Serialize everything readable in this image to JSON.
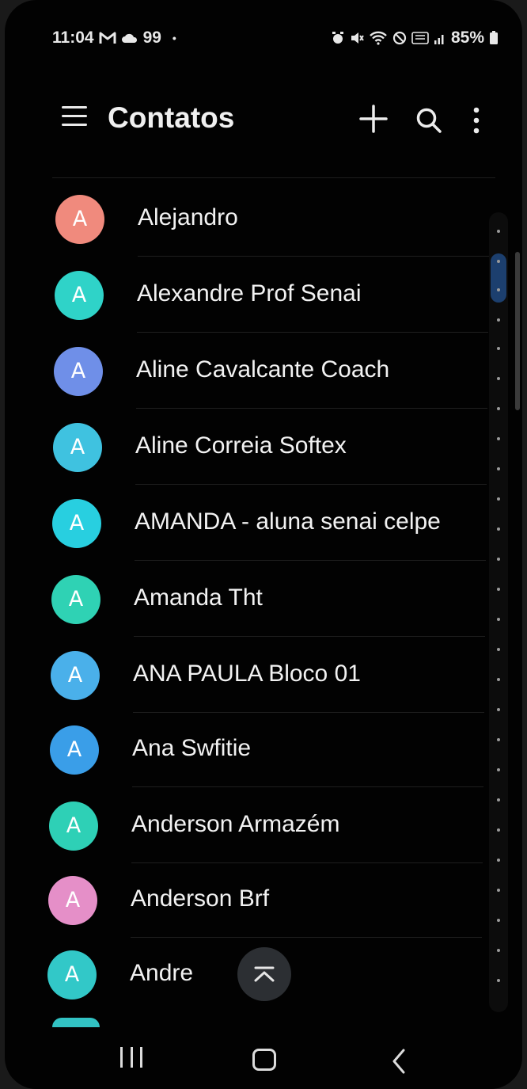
{
  "status": {
    "time": "11:04",
    "notification_icons": [
      "gmail-icon",
      "cloud-icon"
    ],
    "notification_text": "99",
    "dot": "•",
    "battery": "85%"
  },
  "appbar": {
    "title": "Contatos"
  },
  "contacts": [
    {
      "initial": "A",
      "name": "Alejandro",
      "color": "#f08a7d"
    },
    {
      "initial": "A",
      "name": "Alexandre Prof Senai",
      "color": "#2fd3c8"
    },
    {
      "initial": "A",
      "name": "Aline Cavalcante Coach",
      "color": "#6f8fe8"
    },
    {
      "initial": "A",
      "name": "Aline Correia Softex",
      "color": "#3fc2e0"
    },
    {
      "initial": "A",
      "name": "AMANDA - aluna senai celpe",
      "color": "#28cfe0"
    },
    {
      "initial": "A",
      "name": "Amanda Tht",
      "color": "#2fd2b4"
    },
    {
      "initial": "A",
      "name": "ANA PAULA Bloco 01",
      "color": "#4ab0ea"
    },
    {
      "initial": "A",
      "name": "Ana Swfitie",
      "color": "#3a9ee8"
    },
    {
      "initial": "A",
      "name": "Anderson Armazém",
      "color": "#2ed0b6"
    },
    {
      "initial": "A",
      "name": "Anderson Brf",
      "color": "#e58fc8"
    },
    {
      "initial": "A",
      "name": "Andre",
      "color": "#32c8c8"
    }
  ],
  "colors": {
    "background": "#020202",
    "text": "#f2f2f2",
    "index_active": "#1c3f6e"
  }
}
